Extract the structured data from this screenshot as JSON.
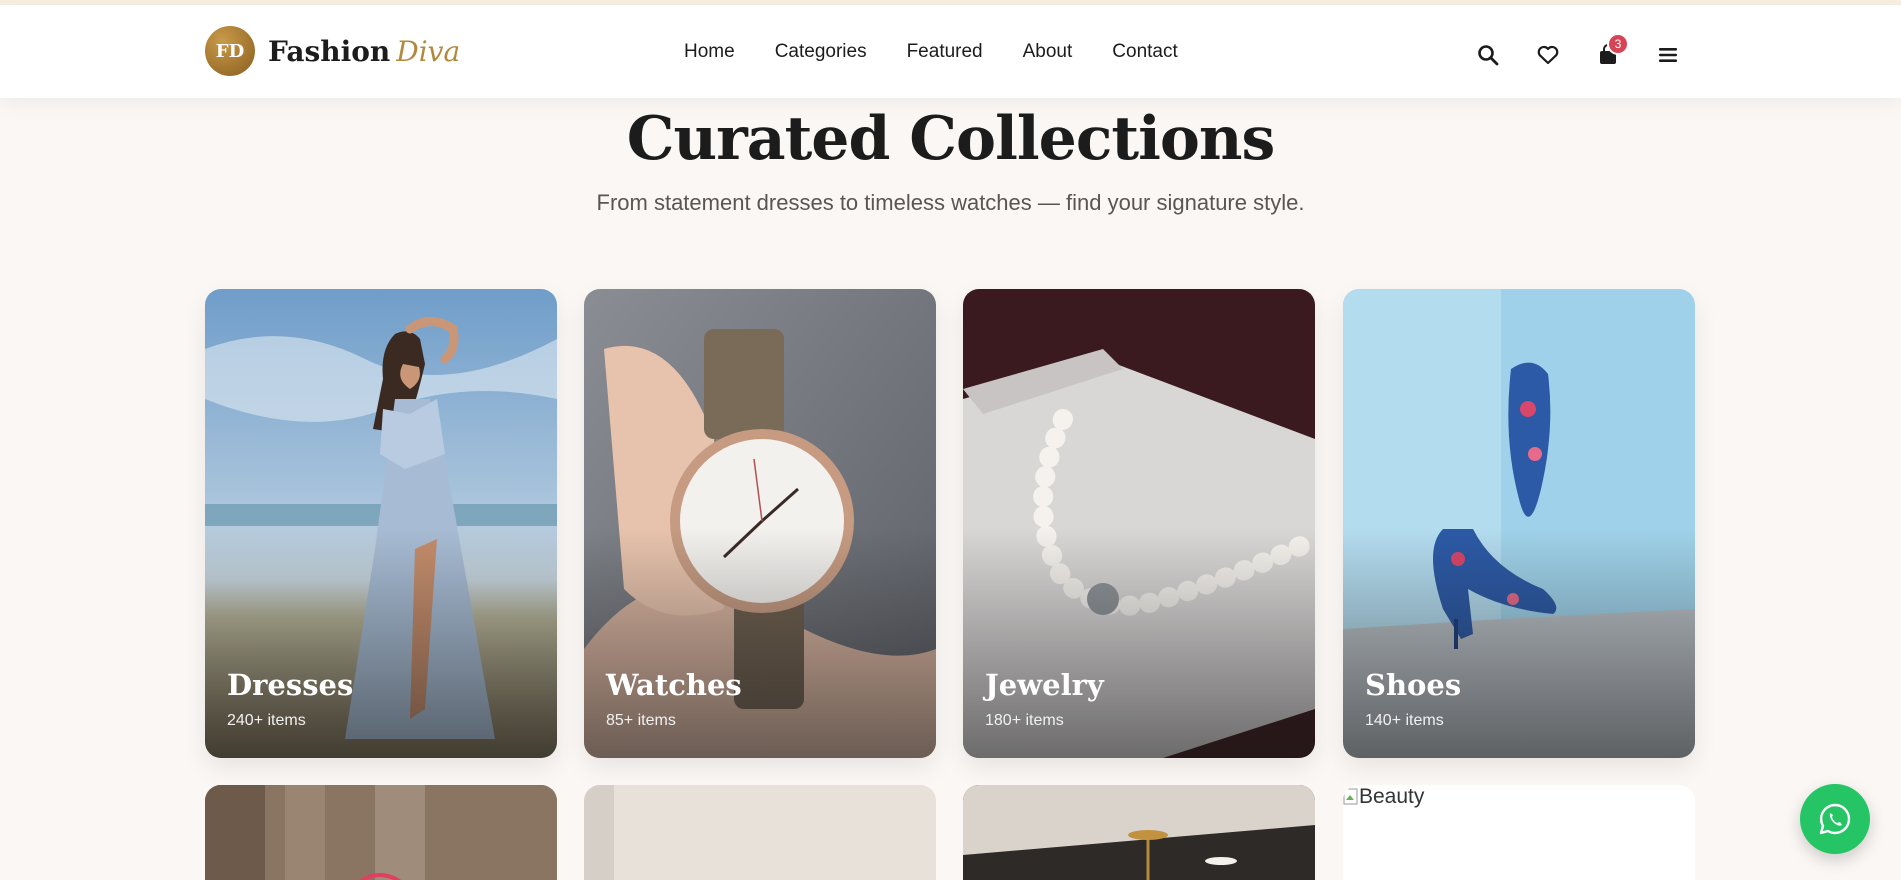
{
  "brand": {
    "badge": "FD",
    "name": "Fashion",
    "accent": "Diva",
    "colors": {
      "gold": "#b28a3e",
      "badge_dark": "#8a5e1f"
    }
  },
  "nav": {
    "items": [
      "Home",
      "Categories",
      "Featured",
      "About",
      "Contact"
    ]
  },
  "header_icons": {
    "search": "search-icon",
    "wishlist": "heart-icon",
    "cart": "shopping-bag-icon",
    "cart_count": "3",
    "menu": "hamburger-menu-icon"
  },
  "section": {
    "title": "Curated Collections",
    "subtitle": "From statement dresses to timeless watches — find your signature style."
  },
  "categories": [
    {
      "name": "Dresses",
      "count": "240+ items"
    },
    {
      "name": "Watches",
      "count": "85+ items"
    },
    {
      "name": "Jewelry",
      "count": "180+ items"
    },
    {
      "name": "Shoes",
      "count": "140+ items"
    }
  ],
  "second_row": {
    "broken_image_alt": "Beauty"
  },
  "floating": {
    "whatsapp": "whatsapp-icon",
    "color": "#25c566"
  }
}
